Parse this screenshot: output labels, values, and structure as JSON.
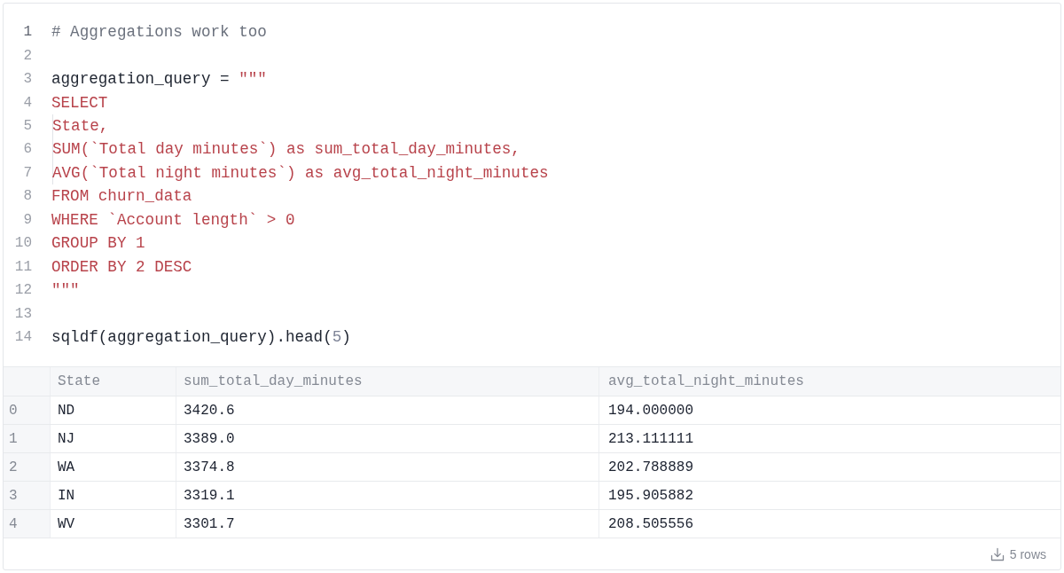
{
  "editor": {
    "lines": [
      {
        "number": "1",
        "active": true,
        "tokens": [
          {
            "text": "# Aggregations work too",
            "kind": "comment"
          }
        ]
      },
      {
        "number": "2",
        "active": false
      },
      {
        "number": "3",
        "active": false,
        "tokens": [
          {
            "text": "aggregation_query = ",
            "kind": "plain"
          },
          {
            "text": "\"\"\"",
            "kind": "string"
          }
        ]
      },
      {
        "number": "4",
        "active": false,
        "tokens": [
          {
            "text": "SELECT",
            "kind": "string"
          }
        ]
      },
      {
        "number": "5",
        "active": false,
        "tokens": [
          {
            "text": "  State,",
            "kind": "string"
          }
        ]
      },
      {
        "number": "6",
        "active": false,
        "tokens": [
          {
            "text": "  SUM(`Total day minutes`) as sum_total_day_minutes,",
            "kind": "string"
          }
        ]
      },
      {
        "number": "7",
        "active": false,
        "tokens": [
          {
            "text": "  AVG(`Total night minutes`) as avg_total_night_minutes",
            "kind": "string"
          }
        ]
      },
      {
        "number": "8",
        "active": false,
        "tokens": [
          {
            "text": "FROM churn_data",
            "kind": "string"
          }
        ]
      },
      {
        "number": "9",
        "active": false,
        "tokens": [
          {
            "text": "WHERE `Account length` > 0",
            "kind": "string"
          }
        ]
      },
      {
        "number": "10",
        "active": false,
        "tokens": [
          {
            "text": "GROUP BY 1",
            "kind": "string"
          }
        ]
      },
      {
        "number": "11",
        "active": false,
        "tokens": [
          {
            "text": "ORDER BY 2 DESC",
            "kind": "string"
          }
        ]
      },
      {
        "number": "12",
        "active": false,
        "tokens": [
          {
            "text": "\"\"\"",
            "kind": "string"
          }
        ]
      },
      {
        "number": "13",
        "active": false
      },
      {
        "number": "14",
        "active": false,
        "tokens": [
          {
            "text": "sqldf(aggregation_query).head(",
            "kind": "plain"
          },
          {
            "text": "5",
            "kind": "number"
          },
          {
            "text": ")",
            "kind": "plain"
          }
        ]
      }
    ]
  },
  "table": {
    "columns": [
      "State",
      "sum_total_day_minutes",
      "avg_total_night_minutes"
    ],
    "rows": [
      {
        "index": "0",
        "cells": [
          "ND",
          "3420.6",
          "194.000000"
        ]
      },
      {
        "index": "1",
        "cells": [
          "NJ",
          "3389.0",
          "213.111111"
        ]
      },
      {
        "index": "2",
        "cells": [
          "WA",
          "3374.8",
          "202.788889"
        ]
      },
      {
        "index": "3",
        "cells": [
          "IN",
          "3319.1",
          "195.905882"
        ]
      },
      {
        "index": "4",
        "cells": [
          "WV",
          "3301.7",
          "208.505556"
        ]
      }
    ]
  },
  "footer": {
    "row_count": "5 rows"
  }
}
